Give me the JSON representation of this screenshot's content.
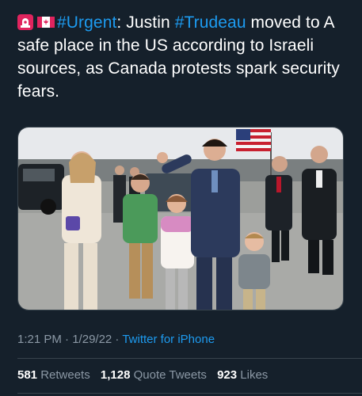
{
  "tweet": {
    "text_before_tag1": ": Justin ",
    "hashtag1": "#Urgent",
    "hashtag2": "#Trudeau",
    "text_after_tag2": " moved to A safe place in the US according to Israeli sources, as Canada protests spark security fears.",
    "emoji1": "siren-icon",
    "emoji2": "canada-flag-icon"
  },
  "meta": {
    "time": "1:21 PM",
    "separator": " · ",
    "date": "1/29/22",
    "source": "Twitter for iPhone"
  },
  "stats": {
    "retweets_count": "581",
    "retweets_label": " Retweets",
    "quotes_count": "1,128",
    "quotes_label": " Quote Tweets",
    "likes_count": "923",
    "likes_label": " Likes"
  },
  "colors": {
    "background": "#15202b",
    "accent": "#1d9bf0",
    "secondary_text": "#8b98a5",
    "divider": "#38444d"
  }
}
